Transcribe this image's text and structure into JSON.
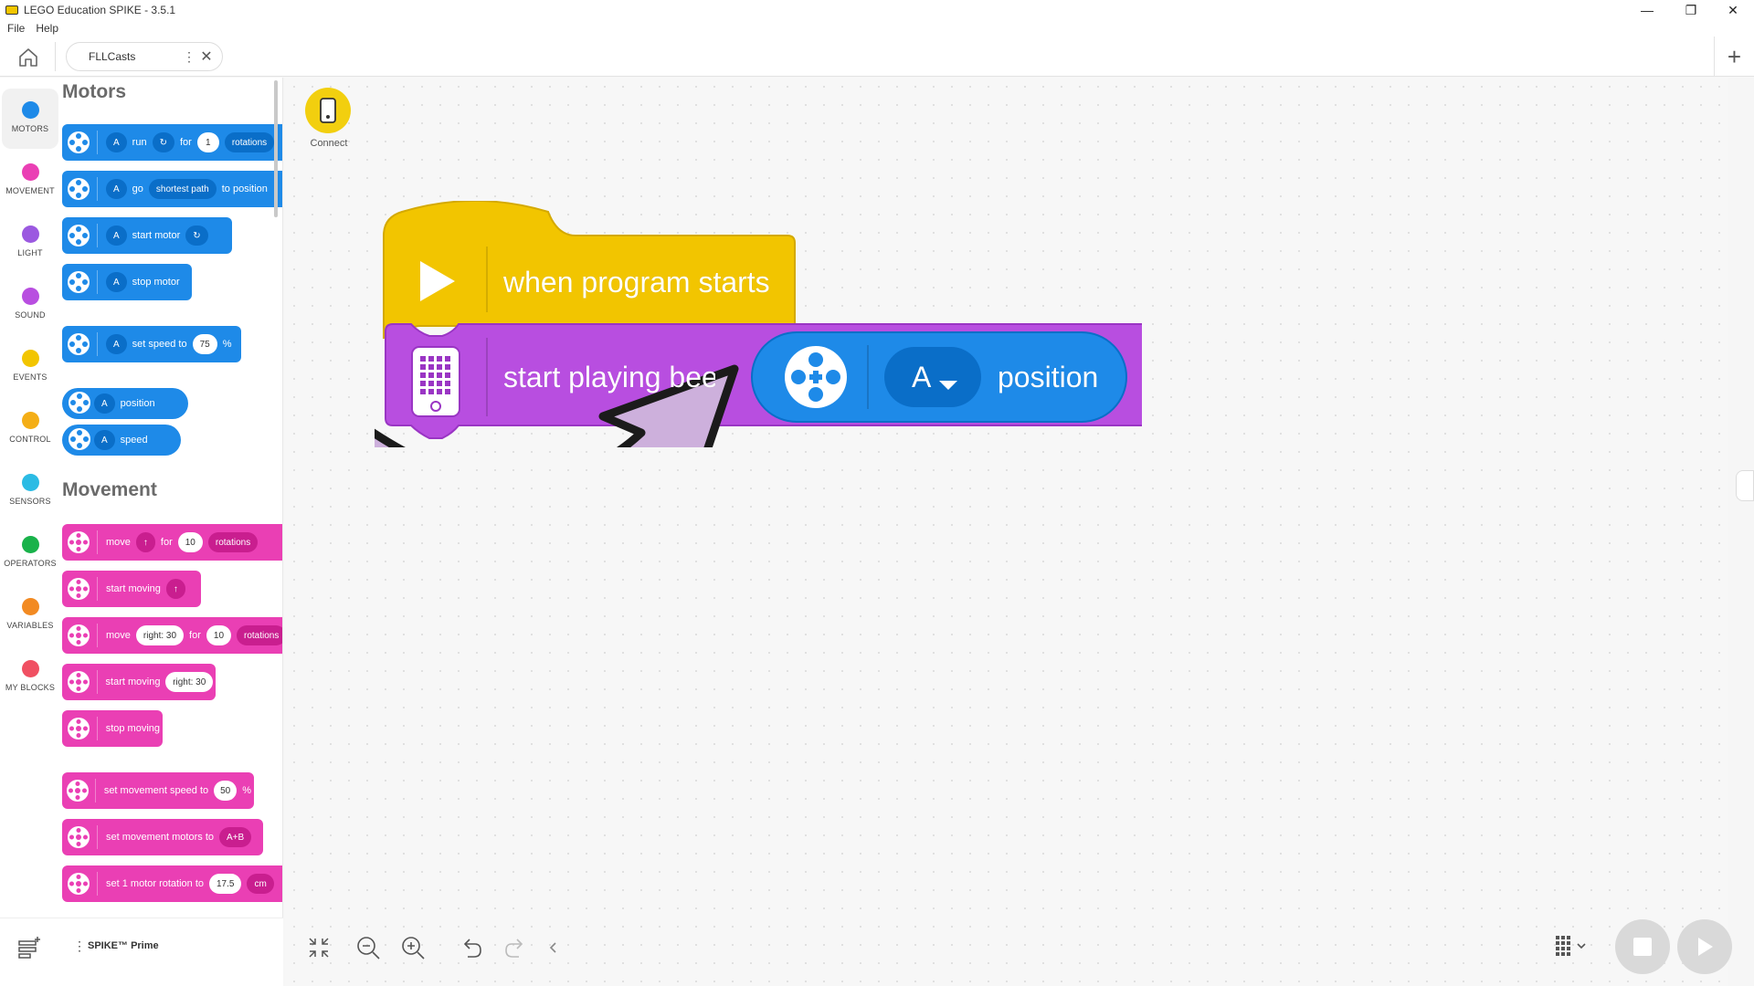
{
  "window": {
    "title": "LEGO Education SPIKE - 3.5.1",
    "minimize": "—",
    "maximize": "❐",
    "close": "✕"
  },
  "menu": {
    "file": "File",
    "help": "Help"
  },
  "tabs": {
    "project_name": "FLLCasts",
    "kebab": "⋮",
    "close": "✕",
    "add": "+"
  },
  "categories": [
    {
      "label": "MOTORS",
      "color": "#1e8ae8"
    },
    {
      "label": "MOVEMENT",
      "color": "#ea3fb4"
    },
    {
      "label": "LIGHT",
      "color": "#9b59e0"
    },
    {
      "label": "SOUND",
      "color": "#b84ee0"
    },
    {
      "label": "EVENTS",
      "color": "#f2c500"
    },
    {
      "label": "CONTROL",
      "color": "#f4ae16"
    },
    {
      "label": "SENSORS",
      "color": "#2bbbe4"
    },
    {
      "label": "OPERATORS",
      "color": "#19b24a"
    },
    {
      "label": "VARIABLES",
      "color": "#f28a22"
    },
    {
      "label": "MY BLOCKS",
      "color": "#f05062"
    }
  ],
  "palette": {
    "motors_title": "Motors",
    "movement_title": "Movement",
    "motor_blocks": {
      "run": {
        "port": "A",
        "t1": "run",
        "dir": "↻",
        "t2": "for",
        "value": "1",
        "unit": "rotations"
      },
      "go": {
        "port": "A",
        "t1": "go",
        "path": "shortest path",
        "t2": "to position"
      },
      "start": {
        "port": "A",
        "t1": "start motor",
        "dir": "↻"
      },
      "stop": {
        "port": "A",
        "t1": "stop motor"
      },
      "speed": {
        "port": "A",
        "t1": "set speed to",
        "value": "75",
        "t2": "%"
      },
      "position_reporter": {
        "port": "A",
        "t1": "position"
      },
      "speed_reporter": {
        "port": "A",
        "t1": "speed"
      }
    },
    "movement_blocks": {
      "move": {
        "t1": "move",
        "dir": "↑",
        "t2": "for",
        "value": "10",
        "unit": "rotations"
      },
      "start_moving": {
        "t1": "start moving",
        "dir": "↑"
      },
      "move_steer": {
        "t1": "move",
        "steer": "right: 30",
        "t2": "for",
        "value": "10",
        "unit": "rotations"
      },
      "start_moving_steer": {
        "t1": "start moving",
        "steer": "right: 30"
      },
      "stop_moving": {
        "t1": "stop moving"
      },
      "set_speed": {
        "t1": "set movement speed to",
        "value": "50",
        "t2": "%"
      },
      "set_motors": {
        "t1": "set movement motors to",
        "value": "A+B"
      },
      "set_rotation": {
        "t1": "set 1 motor rotation to",
        "value": "17.5",
        "unit": "cm"
      }
    }
  },
  "canvas": {
    "connect_label": "Connect",
    "hat_block": {
      "label": "when program starts",
      "color": "#f2c500"
    },
    "sound_block": {
      "label": "start playing beep",
      "color": "#b84ee0"
    },
    "dropped_reporter": {
      "port": "A",
      "label": "position",
      "color": "#1e8ae8"
    }
  },
  "bottom": {
    "hub_label": "SPIKE™ Prime",
    "kebab": "⋮"
  }
}
